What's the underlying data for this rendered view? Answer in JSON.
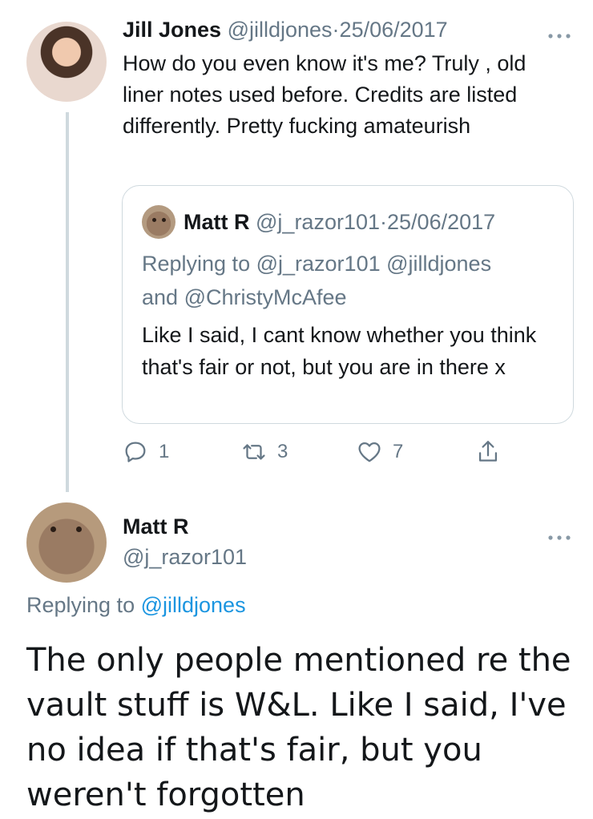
{
  "tweet": {
    "author_name": "Jill Jones",
    "author_handle": "@jilldjones",
    "separator": "·",
    "date": "25/06/2017",
    "text": "How do you even know it's me? Truly , old liner notes used before. Credits are listed differently. Pretty fucking amateurish",
    "more_icon": "more-horizontal-icon",
    "quoted": {
      "author_name": "Matt R",
      "author_handle": "@j_razor101",
      "separator": "·",
      "date": "25/06/2017",
      "replying_prefix": "Replying to",
      "replying_to": "@j_razor101 @jilldjones",
      "replying_and": "and",
      "replying_to_2": "@ChristyMcAfee",
      "text": "Like I said, I cant know whether you think that's fair or not, but you are in there x"
    },
    "actions": {
      "reply_count": "1",
      "retweet_count": "3",
      "like_count": "7"
    }
  },
  "reply_tweet": {
    "author_name": "Matt R",
    "author_handle": "@j_razor101",
    "replying_prefix": "Replying to",
    "replying_to": "@jilldjones",
    "text": "The only people mentioned re the vault stuff is W&L. Like I said, I've no idea if that's fair, but you weren't forgotten"
  },
  "colors": {
    "link": "#1b95e0",
    "muted": "#657786",
    "text": "#14171a",
    "border": "#cfd9de"
  }
}
